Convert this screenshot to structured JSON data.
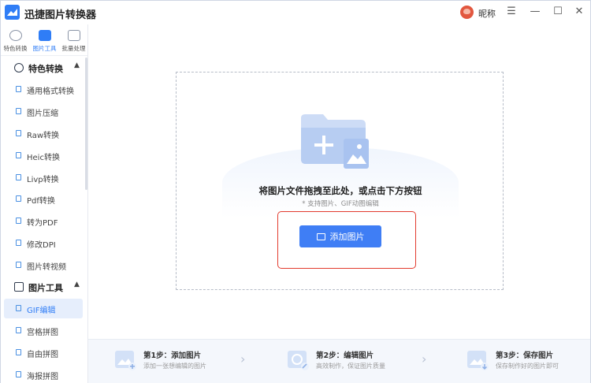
{
  "app": {
    "title": "迅捷图片转换器",
    "nickname": "昵称"
  },
  "window_controls": {
    "menu": "☰",
    "minimize": "—",
    "maximize": "☐",
    "close": "✕"
  },
  "top_tabs": [
    {
      "label": "特色转换",
      "icon": "swap-icon"
    },
    {
      "label": "图片工具",
      "icon": "image-tool-icon",
      "active": true
    },
    {
      "label": "批量处理",
      "icon": "batch-icon"
    }
  ],
  "sidebar": {
    "sections": [
      {
        "label": "特色转换",
        "items": [
          "通用格式转换",
          "图片压缩",
          "Raw转换",
          "Heic转换",
          "Livp转换",
          "Pdf转换",
          "转为PDF",
          "修改DPI",
          "图片转视频"
        ]
      },
      {
        "label": "图片工具",
        "items": [
          "GIF编辑",
          "宫格拼图",
          "自由拼图",
          "海报拼图"
        ],
        "active_item": "GIF编辑"
      }
    ]
  },
  "dropzone": {
    "title": "将图片文件拖拽至此处，或点击下方按钮",
    "hint": "* 支持图片、GIF动图编辑",
    "button": "添加图片"
  },
  "steps": [
    {
      "title": "第1步：添加图片",
      "desc": "添加一张想编辑的图片"
    },
    {
      "title": "第2步：编辑图片",
      "desc": "高效制作，保证图片质量"
    },
    {
      "title": "第3步：保存图片",
      "desc": "保存制作好的图片即可"
    }
  ],
  "colors": {
    "accent": "#3f7ef5",
    "highlight_border": "#e23b2e",
    "active_bg": "#e6eefc"
  }
}
